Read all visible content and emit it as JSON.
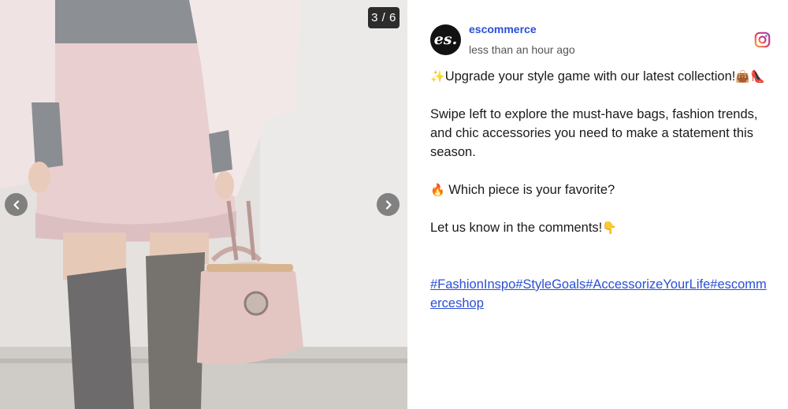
{
  "carousel": {
    "counter": "3 / 6",
    "prev_icon": "chevron-left-icon",
    "next_icon": "chevron-right-icon"
  },
  "post": {
    "avatar_text": "es.",
    "author": "escommerce",
    "timestamp": "less than an hour ago",
    "platform_icon": "instagram-icon",
    "caption": {
      "line1_emoji": "✨",
      "line1": "Upgrade your style game with our latest collection!",
      "line1_end_emoji": "👜👠",
      "paragraph2": "Swipe left to explore the must-have bags, fashion trends, and chic accessories you need to make a statement this season.",
      "line3_emoji": "🔥",
      "line3": " Which piece is your favorite?",
      "line4": "Let us know in the comments!",
      "line4_emoji": "👇",
      "hashtags": "#FashionInspo#StyleGoals#AccessorizeYourLife#escommerceshop"
    }
  },
  "colors": {
    "link": "#2a4fd6",
    "text": "#1a1a1a",
    "avatar_bg": "#121212"
  }
}
